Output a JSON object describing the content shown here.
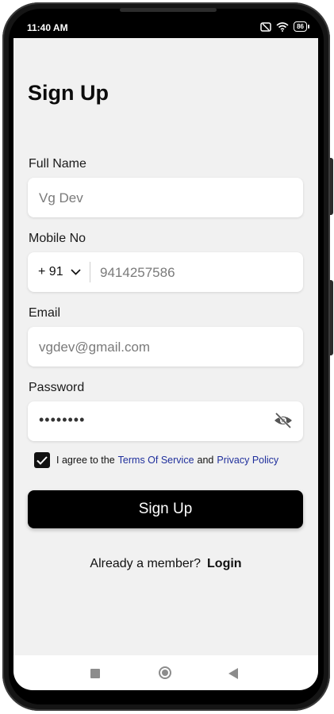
{
  "status": {
    "time": "11:40 AM",
    "battery": "86"
  },
  "form": {
    "title": "Sign Up",
    "full_name_label": "Full Name",
    "full_name_value": "Vg Dev",
    "mobile_label": "Mobile No",
    "country_code": "+ 91",
    "mobile_value": "9414257586",
    "email_label": "Email",
    "email_value": "vgdev@gmail.com",
    "password_label": "Password",
    "password_value": "••••••••",
    "agree_prefix": "I agree to the",
    "terms_link": "Terms Of Service",
    "agree_and": "and",
    "privacy_link": "Privacy Policy",
    "agree_checked": true,
    "submit_label": "Sign Up",
    "member_text": "Already a member?",
    "login_link": "Login"
  },
  "icons": {
    "dropdown": "chevron-down-icon",
    "password_toggle": "eye-off-icon",
    "checkbox": "check-icon",
    "nav_recent": "square-icon",
    "nav_home": "circle-icon",
    "nav_back": "triangle-back-icon",
    "status": [
      "sim-off-icon",
      "wifi-icon",
      "battery-icon"
    ]
  },
  "colors": {
    "link": "#1f2f9c",
    "primary_button": "#000000",
    "background": "#f1f1f1"
  }
}
